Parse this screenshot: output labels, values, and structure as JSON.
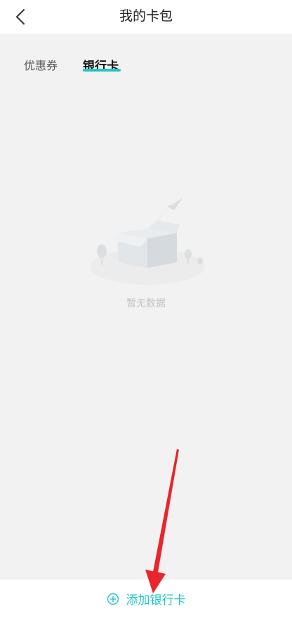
{
  "header": {
    "title": "我的卡包",
    "back_icon": "chevron-left-icon"
  },
  "tabs": [
    {
      "label": "优惠券",
      "active": false
    },
    {
      "label": "银行卡",
      "active": true
    }
  ],
  "empty_state": {
    "text": "暂无数据",
    "illustration": "empty-box-with-paper-plane"
  },
  "bottom": {
    "add_label": "添加银行卡",
    "icon": "plus-circle-icon"
  },
  "colors": {
    "accent": "#1fc6c6",
    "annotation_arrow": "#e8262b",
    "background": "#f2f2f2"
  }
}
